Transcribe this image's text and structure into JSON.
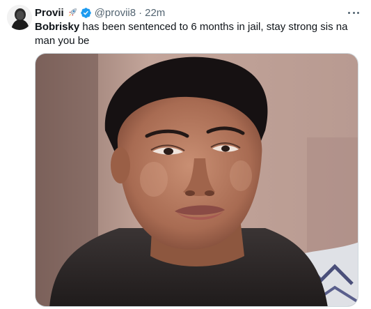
{
  "tweet": {
    "author_name": "Provii",
    "author_emoji": "rocket-emoji",
    "verified_badge": "verified-icon",
    "handle": "@provii8",
    "separator": "·",
    "time": "22m",
    "mention": "Bobrisky",
    "text_rest": " has been sentenced to 6 months in jail, stay strong sis na man you be",
    "more_menu": "more-options-icon",
    "media": "tweet-photo"
  },
  "colors": {
    "text_primary": "#0f1419",
    "text_secondary": "#536471",
    "verified_blue": "#1d9bf0",
    "border": "#cfd9de"
  }
}
